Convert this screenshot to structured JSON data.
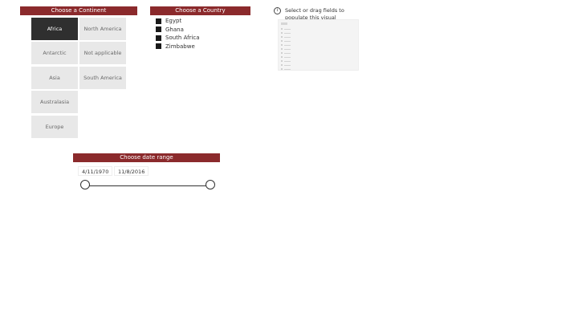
{
  "continent_slicer": {
    "title": "Choose a Continent",
    "items": [
      {
        "label": "Africa",
        "selected": true
      },
      {
        "label": "North America",
        "selected": false
      },
      {
        "label": "Antarctic",
        "selected": false
      },
      {
        "label": "Not applicable",
        "selected": false
      },
      {
        "label": "Asia",
        "selected": false
      },
      {
        "label": "South America",
        "selected": false
      },
      {
        "label": "Australasia",
        "selected": false
      },
      {
        "label": "Europe",
        "selected": false
      }
    ]
  },
  "country_slicer": {
    "title": "Choose a Country",
    "items": [
      {
        "label": "Egypt",
        "checked": true
      },
      {
        "label": "Ghana",
        "checked": true
      },
      {
        "label": "South Africa",
        "checked": true
      },
      {
        "label": "Zimbabwe",
        "checked": true
      }
    ]
  },
  "empty_visual": {
    "message": "Select or drag fields to populate this visual",
    "icon": "info-icon"
  },
  "date_slicer": {
    "title": "Choose date range",
    "start": "4/11/1970",
    "end": "11/8/2016"
  },
  "colors": {
    "header_bg": "#8b2a2c",
    "tile_selected": "#2f2f2f",
    "tile_default": "#e8e8e8"
  }
}
